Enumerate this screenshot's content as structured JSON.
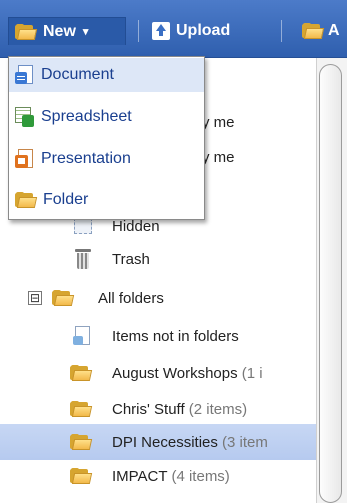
{
  "toolbar": {
    "new_label": "New",
    "new_caret": "▾",
    "upload_label": "Upload",
    "third_label": "A"
  },
  "new_menu": {
    "items": [
      {
        "label": "Document",
        "icon": "google-doc-icon"
      },
      {
        "label": "Spreadsheet",
        "icon": "spreadsheet-icon"
      },
      {
        "label": "Presentation",
        "icon": "presentation-icon"
      },
      {
        "label": "Folder",
        "icon": "folder-icon"
      }
    ]
  },
  "tree": {
    "partial_rows": [
      {
        "visible_text": "y me"
      },
      {
        "visible_text": "y me"
      }
    ],
    "hidden_label": "Hidden",
    "trash_label": "Trash",
    "all_folders_label": "All folders",
    "all_folders_toggle": "⊟",
    "items_not_in_folders_label": "Items not in folders",
    "folders": [
      {
        "name": "August Workshops",
        "count": "(1 i"
      },
      {
        "name": "Chris' Stuff",
        "count": "(2 items)"
      },
      {
        "name": "DPI Necessities",
        "count": "(3 item",
        "selected": true
      },
      {
        "name": "IMPACT",
        "count": "(4 items)"
      }
    ]
  },
  "colors": {
    "toolbar": "#3a6bbd",
    "menu_text": "#1a3f8f",
    "selected_row": "#bccff2",
    "folder_yellow": "#f2b94a"
  }
}
